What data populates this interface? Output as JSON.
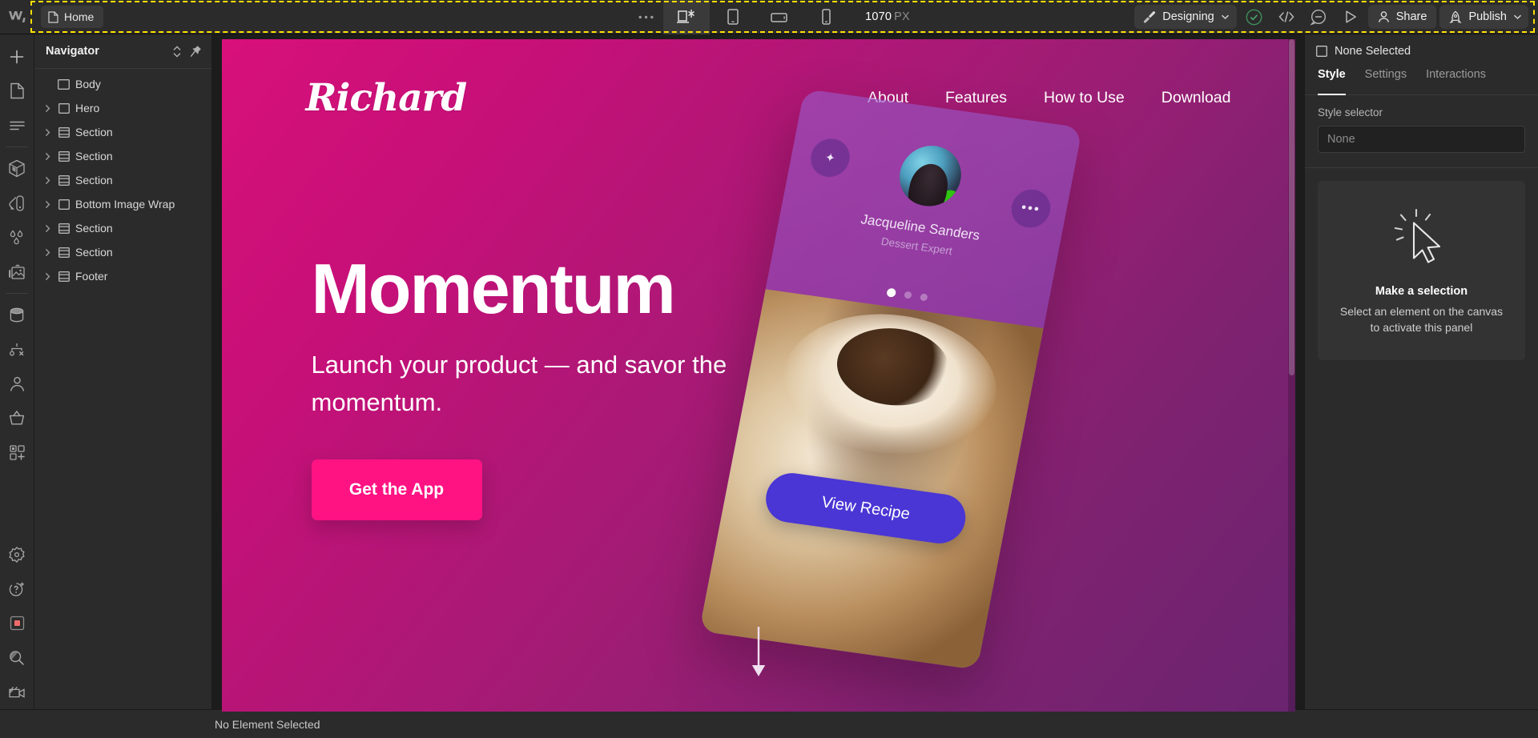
{
  "app": {
    "name": "webflow-designer",
    "logo_icon": "webflow-logo-icon"
  },
  "topbar": {
    "page_chip": {
      "label": "Home",
      "icon": "page-icon"
    },
    "more_button": {
      "label": "…",
      "icon": "ellipsis-icon"
    },
    "breakpoints": [
      {
        "name": "desktop",
        "icon": "desktop-breakpoint-icon",
        "active": true
      },
      {
        "name": "tablet",
        "icon": "tablet-icon",
        "active": false
      },
      {
        "name": "mobile-landscape",
        "icon": "mobile-landscape-icon",
        "active": false
      },
      {
        "name": "mobile-portrait",
        "icon": "mobile-portrait-icon",
        "active": false
      }
    ],
    "viewport_width": "1070",
    "viewport_unit": "PX",
    "mode": {
      "label": "Designing",
      "icon": "paintbrush-icon",
      "chevron": "chevron-down-icon"
    },
    "actions": [
      {
        "name": "audit-check",
        "icon": "check-circle-icon",
        "color": "#3f8f5c"
      },
      {
        "name": "code-export",
        "icon": "code-brackets-icon"
      },
      {
        "name": "comments",
        "icon": "comment-bubble-icon"
      },
      {
        "name": "preview-play",
        "icon": "play-triangle-icon"
      }
    ],
    "share": {
      "label": "Share",
      "icon": "person-icon"
    },
    "publish": {
      "label": "Publish",
      "icon": "rocket-icon",
      "chevron": "chevron-down-icon"
    },
    "highlight_color": "#ffe000"
  },
  "left_rail": {
    "groups": [
      [
        {
          "name": "add-elements",
          "icon": "plus-icon"
        },
        {
          "name": "pages",
          "icon": "page-icon"
        },
        {
          "name": "navigator",
          "icon": "navigator-lines-icon"
        }
      ],
      [
        {
          "name": "components",
          "icon": "cube-icon"
        },
        {
          "name": "style-manager",
          "icon": "paint-swatch-icon"
        },
        {
          "name": "variables",
          "icon": "water-drops-icon"
        },
        {
          "name": "assets",
          "icon": "image-icon"
        }
      ],
      [
        {
          "name": "cms",
          "icon": "database-icon"
        },
        {
          "name": "logic",
          "icon": "logic-flow-icon"
        },
        {
          "name": "users",
          "icon": "person-icon"
        },
        {
          "name": "ecommerce",
          "icon": "basket-icon"
        },
        {
          "name": "apps",
          "icon": "apps-grid-plus-icon"
        }
      ]
    ],
    "bottom": [
      {
        "name": "settings",
        "icon": "gear-icon"
      },
      {
        "name": "help",
        "icon": "question-plus-icon"
      },
      {
        "name": "record-stop",
        "icon": "red-square-icon",
        "color": "#ef6b6b"
      },
      {
        "name": "search",
        "icon": "magnifier-icon"
      },
      {
        "name": "video",
        "icon": "video-camera-icon"
      }
    ]
  },
  "navigator": {
    "title": "Navigator",
    "sort_icon": "sort-updown-icon",
    "pin_icon": "pin-icon",
    "tree": [
      {
        "label": "Body",
        "icon": "body-icon",
        "depth": 0,
        "has_chevron": false
      },
      {
        "label": "Hero",
        "icon": "div-icon",
        "depth": 1,
        "has_chevron": true
      },
      {
        "label": "Section",
        "icon": "section-icon",
        "depth": 1,
        "has_chevron": true
      },
      {
        "label": "Section",
        "icon": "section-icon",
        "depth": 1,
        "has_chevron": true
      },
      {
        "label": "Section",
        "icon": "section-icon",
        "depth": 1,
        "has_chevron": true
      },
      {
        "label": "Bottom Image Wrap",
        "icon": "div-icon",
        "depth": 1,
        "has_chevron": true
      },
      {
        "label": "Section",
        "icon": "section-icon",
        "depth": 1,
        "has_chevron": true
      },
      {
        "label": "Section",
        "icon": "section-icon",
        "depth": 1,
        "has_chevron": true
      },
      {
        "label": "Footer",
        "icon": "section-icon",
        "depth": 1,
        "has_chevron": true
      }
    ]
  },
  "canvas": {
    "site": {
      "brand": "Richard",
      "nav_links": [
        "About",
        "Features",
        "How to Use",
        "Download"
      ],
      "hero": {
        "heading": "Momentum",
        "subheading": "Launch your product — and savor the momentum.",
        "cta_label": "Get the App",
        "cta_color": "#ff1383"
      },
      "phone_card": {
        "star_glyph": "✦",
        "more_glyph": "•••",
        "person_name": "Jacqueline Sanders",
        "person_role": "Dessert Expert",
        "status_dot_color": "#2ec40f",
        "carousel_dots": 3,
        "carousel_active_index": 0,
        "button_label": "View Recipe",
        "button_color": "#4a36d4"
      },
      "scroll_arrow_icon": "down-arrow-icon",
      "background_start": "#d8107a",
      "background_end": "#6a2470"
    }
  },
  "right_panel": {
    "selection": {
      "label": "None Selected",
      "icon": "element-square-icon"
    },
    "tabs": [
      {
        "label": "Style",
        "active": true
      },
      {
        "label": "Settings",
        "active": false
      },
      {
        "label": "Interactions",
        "active": false
      }
    ],
    "style_selector": {
      "label": "Style selector",
      "value": "None",
      "placeholder": "None"
    },
    "empty_state": {
      "icon": "click-cursor-icon",
      "title": "Make a selection",
      "subtitle": "Select an element on the canvas to activate this panel"
    }
  },
  "statusbar": {
    "message": "No Element Selected"
  }
}
